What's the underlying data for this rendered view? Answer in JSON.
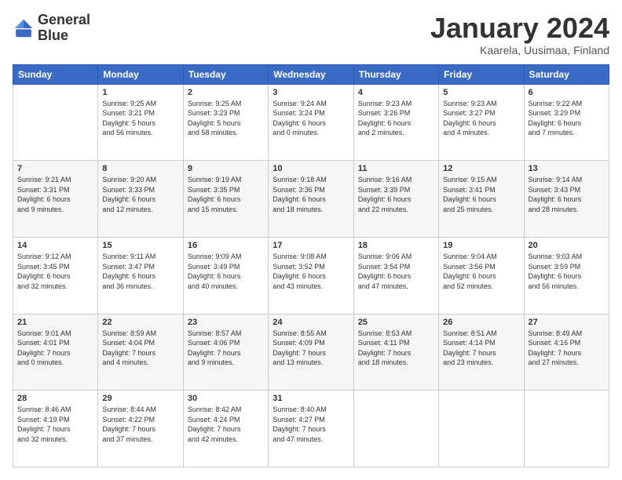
{
  "logo": {
    "line1": "General",
    "line2": "Blue"
  },
  "title": "January 2024",
  "location": "Kaarela, Uusimaa, Finland",
  "weekdays": [
    "Sunday",
    "Monday",
    "Tuesday",
    "Wednesday",
    "Thursday",
    "Friday",
    "Saturday"
  ],
  "weeks": [
    [
      {
        "day": "",
        "info": ""
      },
      {
        "day": "1",
        "info": "Sunrise: 9:25 AM\nSunset: 3:21 PM\nDaylight: 5 hours\nand 56 minutes."
      },
      {
        "day": "2",
        "info": "Sunrise: 9:25 AM\nSunset: 3:23 PM\nDaylight: 5 hours\nand 58 minutes."
      },
      {
        "day": "3",
        "info": "Sunrise: 9:24 AM\nSunset: 3:24 PM\nDaylight: 6 hours\nand 0 minutes."
      },
      {
        "day": "4",
        "info": "Sunrise: 9:23 AM\nSunset: 3:26 PM\nDaylight: 6 hours\nand 2 minutes."
      },
      {
        "day": "5",
        "info": "Sunrise: 9:23 AM\nSunset: 3:27 PM\nDaylight: 6 hours\nand 4 minutes."
      },
      {
        "day": "6",
        "info": "Sunrise: 9:22 AM\nSunset: 3:29 PM\nDaylight: 6 hours\nand 7 minutes."
      }
    ],
    [
      {
        "day": "7",
        "info": "Sunrise: 9:21 AM\nSunset: 3:31 PM\nDaylight: 6 hours\nand 9 minutes."
      },
      {
        "day": "8",
        "info": "Sunrise: 9:20 AM\nSunset: 3:33 PM\nDaylight: 6 hours\nand 12 minutes."
      },
      {
        "day": "9",
        "info": "Sunrise: 9:19 AM\nSunset: 3:35 PM\nDaylight: 6 hours\nand 15 minutes."
      },
      {
        "day": "10",
        "info": "Sunrise: 9:18 AM\nSunset: 3:36 PM\nDaylight: 6 hours\nand 18 minutes."
      },
      {
        "day": "11",
        "info": "Sunrise: 9:16 AM\nSunset: 3:39 PM\nDaylight: 6 hours\nand 22 minutes."
      },
      {
        "day": "12",
        "info": "Sunrise: 9:15 AM\nSunset: 3:41 PM\nDaylight: 6 hours\nand 25 minutes."
      },
      {
        "day": "13",
        "info": "Sunrise: 9:14 AM\nSunset: 3:43 PM\nDaylight: 6 hours\nand 28 minutes."
      }
    ],
    [
      {
        "day": "14",
        "info": "Sunrise: 9:12 AM\nSunset: 3:45 PM\nDaylight: 6 hours\nand 32 minutes."
      },
      {
        "day": "15",
        "info": "Sunrise: 9:11 AM\nSunset: 3:47 PM\nDaylight: 6 hours\nand 36 minutes."
      },
      {
        "day": "16",
        "info": "Sunrise: 9:09 AM\nSunset: 3:49 PM\nDaylight: 6 hours\nand 40 minutes."
      },
      {
        "day": "17",
        "info": "Sunrise: 9:08 AM\nSunset: 3:52 PM\nDaylight: 6 hours\nand 43 minutes."
      },
      {
        "day": "18",
        "info": "Sunrise: 9:06 AM\nSunset: 3:54 PM\nDaylight: 6 hours\nand 47 minutes."
      },
      {
        "day": "19",
        "info": "Sunrise: 9:04 AM\nSunset: 3:56 PM\nDaylight: 6 hours\nand 52 minutes."
      },
      {
        "day": "20",
        "info": "Sunrise: 9:03 AM\nSunset: 3:59 PM\nDaylight: 6 hours\nand 56 minutes."
      }
    ],
    [
      {
        "day": "21",
        "info": "Sunrise: 9:01 AM\nSunset: 4:01 PM\nDaylight: 7 hours\nand 0 minutes."
      },
      {
        "day": "22",
        "info": "Sunrise: 8:59 AM\nSunset: 4:04 PM\nDaylight: 7 hours\nand 4 minutes."
      },
      {
        "day": "23",
        "info": "Sunrise: 8:57 AM\nSunset: 4:06 PM\nDaylight: 7 hours\nand 9 minutes."
      },
      {
        "day": "24",
        "info": "Sunrise: 8:55 AM\nSunset: 4:09 PM\nDaylight: 7 hours\nand 13 minutes."
      },
      {
        "day": "25",
        "info": "Sunrise: 8:53 AM\nSunset: 4:11 PM\nDaylight: 7 hours\nand 18 minutes."
      },
      {
        "day": "26",
        "info": "Sunrise: 8:51 AM\nSunset: 4:14 PM\nDaylight: 7 hours\nand 23 minutes."
      },
      {
        "day": "27",
        "info": "Sunrise: 8:49 AM\nSunset: 4:16 PM\nDaylight: 7 hours\nand 27 minutes."
      }
    ],
    [
      {
        "day": "28",
        "info": "Sunrise: 8:46 AM\nSunset: 4:19 PM\nDaylight: 7 hours\nand 32 minutes."
      },
      {
        "day": "29",
        "info": "Sunrise: 8:44 AM\nSunset: 4:22 PM\nDaylight: 7 hours\nand 37 minutes."
      },
      {
        "day": "30",
        "info": "Sunrise: 8:42 AM\nSunset: 4:24 PM\nDaylight: 7 hours\nand 42 minutes."
      },
      {
        "day": "31",
        "info": "Sunrise: 8:40 AM\nSunset: 4:27 PM\nDaylight: 7 hours\nand 47 minutes."
      },
      {
        "day": "",
        "info": ""
      },
      {
        "day": "",
        "info": ""
      },
      {
        "day": "",
        "info": ""
      }
    ]
  ]
}
